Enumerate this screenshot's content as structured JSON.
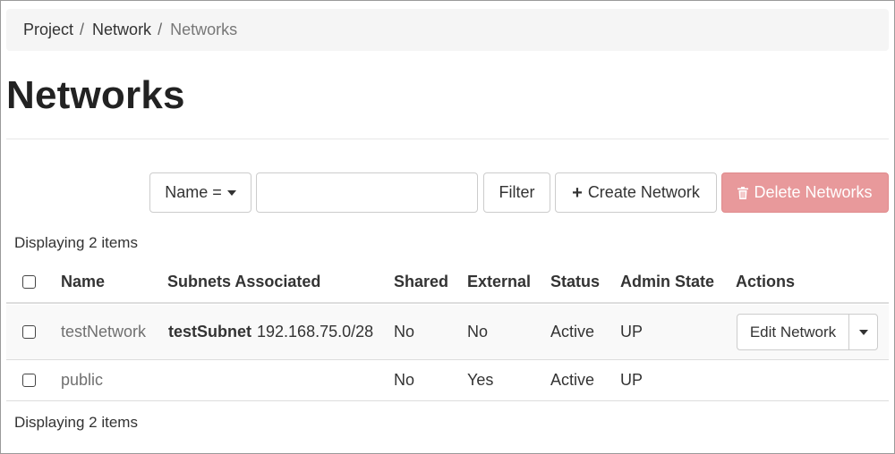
{
  "breadcrumb": {
    "items": [
      "Project",
      "Network",
      "Networks"
    ],
    "separator": "/"
  },
  "page_title": "Networks",
  "toolbar": {
    "filter_select_label": "Name =",
    "search_value": "",
    "filter_label": "Filter",
    "create_label": "Create Network",
    "delete_label": "Delete Networks",
    "delete_color": "#e8999b"
  },
  "table": {
    "count_top": "Displaying 2 items",
    "count_bottom": "Displaying 2 items",
    "headers": {
      "name": "Name",
      "subnets": "Subnets Associated",
      "shared": "Shared",
      "external": "External",
      "status": "Status",
      "admin_state": "Admin State",
      "actions": "Actions"
    },
    "rows": [
      {
        "name": "testNetwork",
        "subnet_name": "testSubnet",
        "subnet_cidr": "192.168.75.0/28",
        "shared": "No",
        "external": "No",
        "status": "Active",
        "admin_state": "UP",
        "action_label": "Edit Network"
      },
      {
        "name": "public",
        "subnet_name": "",
        "subnet_cidr": "",
        "shared": "No",
        "external": "Yes",
        "status": "Active",
        "admin_state": "UP",
        "action_label": ""
      }
    ]
  },
  "icons": {
    "plus": "plus-icon",
    "trash": "trash-icon",
    "caret": "caret-down-icon"
  }
}
